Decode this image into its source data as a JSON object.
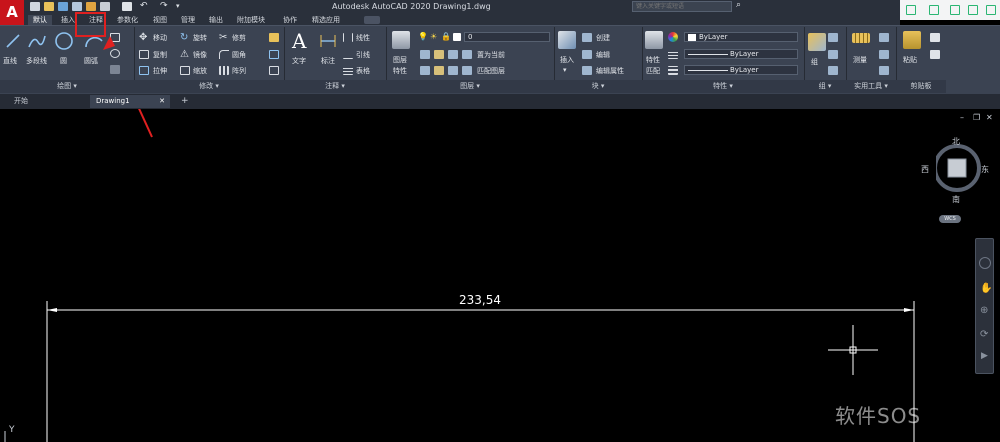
{
  "app": {
    "logo_letter": "A",
    "title": "Autodesk AutoCAD 2020    Drawing1.dwg",
    "search_placeholder": "键入关键字或短语"
  },
  "menu_tabs": [
    "默认",
    "插入",
    "注释",
    "参数化",
    "视图",
    "管理",
    "输出",
    "附加模块",
    "协作",
    "精选应用"
  ],
  "ribbon": {
    "draw": {
      "line": "直线",
      "polyline": "多段线",
      "circle": "圆",
      "arc": "圆弧",
      "footer": "绘图 ▾"
    },
    "modify": {
      "move": "移动",
      "rotate": "旋转",
      "trim": "修剪",
      "copy": "复制",
      "mirror": "镜像",
      "fillet": "圆角",
      "stretch": "拉伸",
      "scale": "缩放",
      "array": "阵列",
      "footer": "修改 ▾"
    },
    "annotation": {
      "text": "文字",
      "dimension": "标注",
      "linear": "线性",
      "leader": "引线",
      "table": "表格",
      "footer": "注释 ▾"
    },
    "layers": {
      "layer_props": "图层",
      "layer_props2": "特性",
      "current_layer": "0",
      "set_current": "置为当前",
      "match_layer": "匹配图层",
      "footer": "图层 ▾"
    },
    "block": {
      "insert": "插入",
      "create": "创建",
      "edit": "编辑",
      "edit_attr": "编辑属性",
      "footer": "块 ▾"
    },
    "properties": {
      "match": "特性",
      "match2": "匹配",
      "color": "ByLayer",
      "linetype": "ByLayer",
      "lineweight": "ByLayer",
      "footer": "特性 ▾"
    },
    "groups": {
      "group": "组",
      "footer": "组 ▾"
    },
    "utilities": {
      "measure": "测量",
      "footer": "实用工具 ▾"
    },
    "clipboard": {
      "paste": "粘贴",
      "footer": "剪贴板"
    }
  },
  "file_tabs": {
    "start": "开始",
    "drawing": "Drawing1",
    "close": "✕",
    "add": "+"
  },
  "viewport": {
    "label": "",
    "compass": {
      "north": "北",
      "south": "南",
      "east": "东",
      "west": "西"
    },
    "wcs": "WCS",
    "dimension_value": "233,54",
    "y_axis": "Y"
  },
  "watermark": "软件SOS",
  "colors": {
    "brand_red": "#c8141b",
    "ribbon_bg": "#3b4352",
    "canvas_bg": "#000000",
    "highlight": "#e02020"
  }
}
